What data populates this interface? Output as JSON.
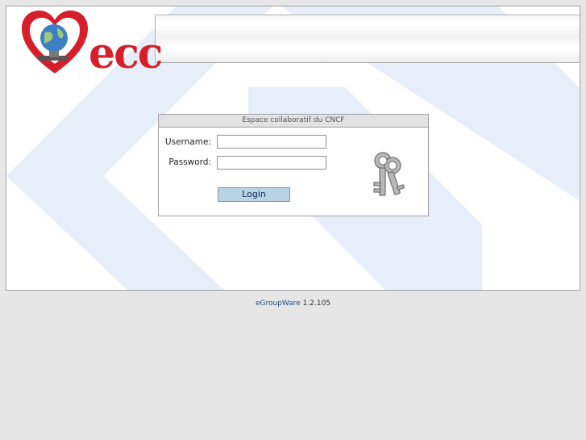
{
  "login": {
    "title": "Espace collaboratif du CNCF",
    "username_label": "Username:",
    "username_value": "",
    "password_label": "Password:",
    "password_value": "",
    "button_label": "Login"
  },
  "logo": {
    "text": "ecc"
  },
  "footer": {
    "link_text": "eGroupWare",
    "version": "1.2.105"
  },
  "colors": {
    "background": "#e6e6e6",
    "chevron": "#e6eefa",
    "logo_red": "#d61f2b",
    "button": "#b9d3e4",
    "link": "#1c4f8a"
  },
  "icons": [
    "heart-globe-logo-icon",
    "keys-icon"
  ]
}
